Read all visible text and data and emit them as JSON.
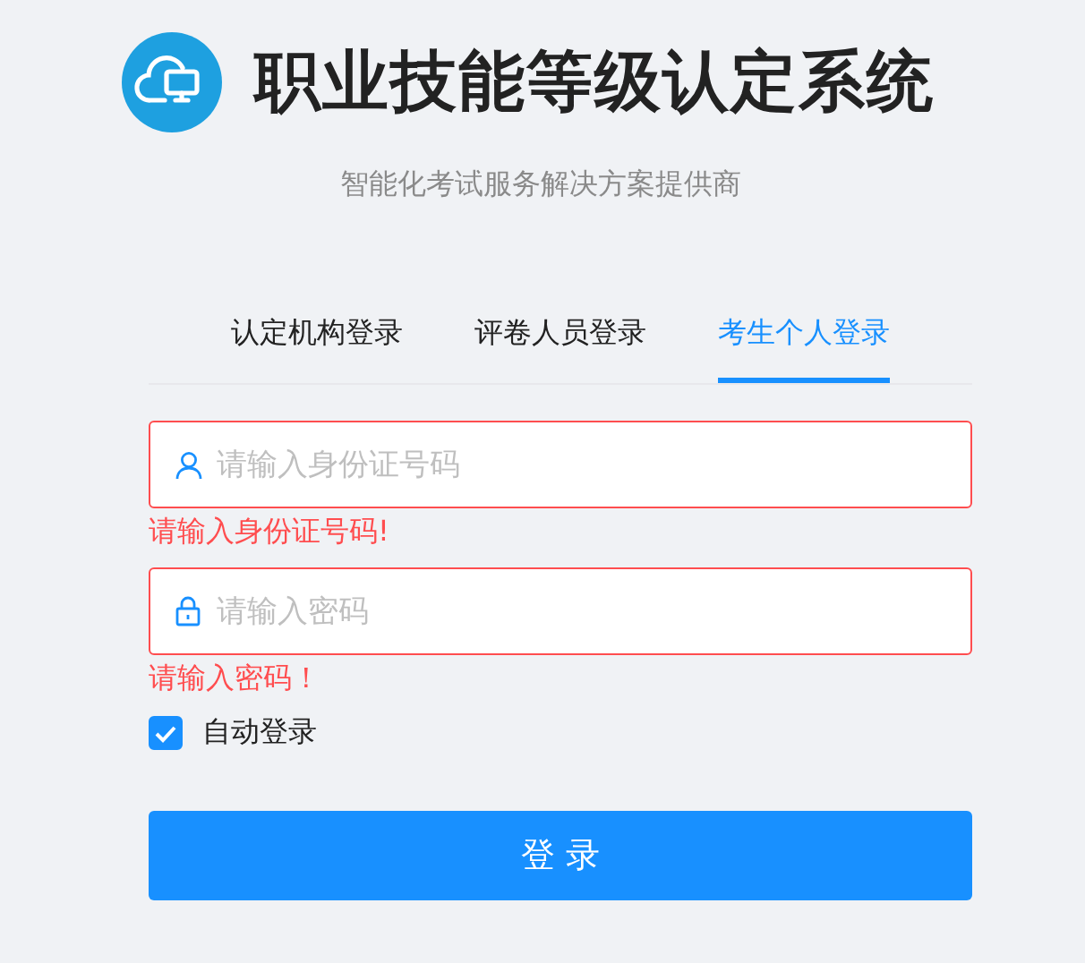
{
  "header": {
    "title": "职业技能等级认定系统",
    "subtitle": "智能化考试服务解决方案提供商"
  },
  "tabs": [
    {
      "label": "认定机构登录",
      "selected": false
    },
    {
      "label": "评卷人员登录",
      "selected": false
    },
    {
      "label": "考生个人登录",
      "selected": true
    }
  ],
  "fields": [
    {
      "kind": "user",
      "placeholder": "请输入身份证号码",
      "error": "请输入身份证号码!"
    },
    {
      "kind": "lock",
      "placeholder": "请输入密码",
      "error": "请输入密码！"
    }
  ],
  "remember": {
    "label": "自动登录",
    "checked": true
  },
  "submit": {
    "label": "登 录"
  }
}
